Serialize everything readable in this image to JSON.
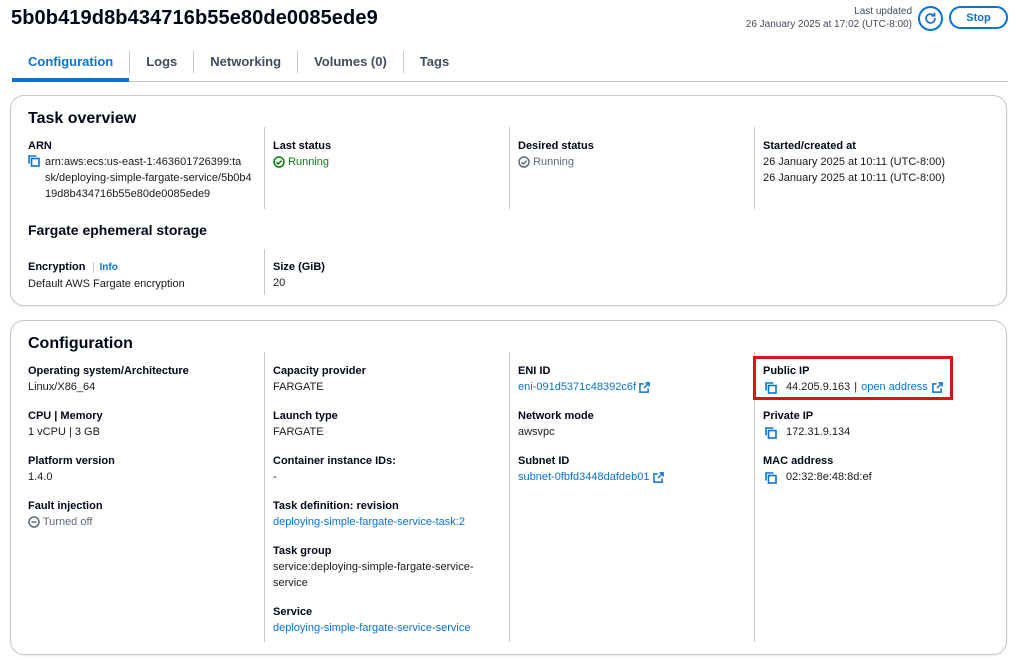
{
  "header": {
    "title": "5b0b419d8b434716b55e80de0085ede9",
    "last_updated_label": "Last updated",
    "last_updated_value": "26 January 2025 at 17:02 (UTC-8:00)",
    "stop_label": "Stop"
  },
  "tabs": [
    {
      "label": "Configuration"
    },
    {
      "label": "Logs"
    },
    {
      "label": "Networking"
    },
    {
      "label": "Volumes (0)"
    },
    {
      "label": "Tags"
    }
  ],
  "task_overview": {
    "title": "Task overview",
    "arn_label": "ARN",
    "arn_value": "arn:aws:ecs:us-east-1:463601726399:task/deploying-simple-fargate-service/5b0b419d8b434716b55e80de0085ede9",
    "arn_lines": [
      "arn:aws:ecs:us-east-1:463601726399:ta",
      "sk/deploying-simple-fargate-service/5b0b4",
      "19d8b434716b55e80de0085ede9"
    ],
    "last_status_label": "Last status",
    "last_status_value": "Running",
    "desired_status_label": "Desired status",
    "desired_status_value": "Running",
    "started_label": "Started/created at",
    "started_value": "26 January 2025 at 10:11 (UTC-8:00)",
    "created_value": "26 January 2025 at 10:11 (UTC-8:00)",
    "storage_title": "Fargate ephemeral storage",
    "encryption_label": "Encryption",
    "info_label": "Info",
    "encryption_value": "Default AWS Fargate encryption",
    "size_label": "Size (GiB)",
    "size_value": "20"
  },
  "configuration": {
    "title": "Configuration",
    "os_label": "Operating system/Architecture",
    "os_value": "Linux/X86_64",
    "cpu_label": "CPU | Memory",
    "cpu_value": "1 vCPU | 3 GB",
    "platform_label": "Platform version",
    "platform_value": "1.4.0",
    "fault_label": "Fault injection",
    "fault_value": "Turned off",
    "capacity_label": "Capacity provider",
    "capacity_value": "FARGATE",
    "launch_label": "Launch type",
    "launch_value": "FARGATE",
    "container_ids_label": "Container instance IDs:",
    "container_ids_value": "-",
    "taskdef_label": "Task definition: revision",
    "taskdef_value": "deploying-simple-fargate-service-task:2",
    "taskgroup_label": "Task group",
    "taskgroup_lines": [
      "service:deploying-simple-fargate-service-",
      "service"
    ],
    "service_label": "Service",
    "service_value": "deploying-simple-fargate-service-service",
    "eni_label": "ENI ID",
    "eni_value": "eni-091d5371c48392c6f",
    "netmode_label": "Network mode",
    "netmode_value": "awsvpc",
    "subnet_label": "Subnet ID",
    "subnet_value": "subnet-0fbfd3448dafdeb01",
    "public_ip_label": "Public IP",
    "public_ip_value": "44.205.9.163",
    "public_ip_sep": "|",
    "open_address_label": "open address",
    "private_ip_label": "Private IP",
    "private_ip_value": "172.31.9.134",
    "mac_label": "MAC address",
    "mac_value": "02:32:8e:48:8d:ef"
  },
  "colors": {
    "link": "#0972d3",
    "success": "#037f0c",
    "highlight": "#d91515"
  },
  "icons": [
    "refresh-icon",
    "copy-icon",
    "status-success-icon",
    "status-stopped-icon",
    "external-link-icon",
    "minus-circle-icon"
  ]
}
